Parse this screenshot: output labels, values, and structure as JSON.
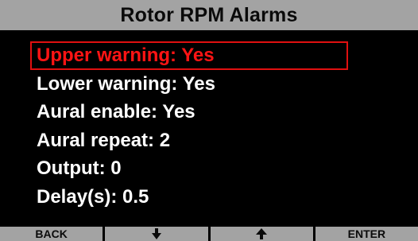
{
  "header": {
    "title": "Rotor RPM Alarms"
  },
  "menu": {
    "items": [
      {
        "label": "Upper warning: Yes",
        "selected": true
      },
      {
        "label": "Lower warning: Yes",
        "selected": false
      },
      {
        "label": "Aural enable: Yes",
        "selected": false
      },
      {
        "label": "Aural repeat: 2",
        "selected": false
      },
      {
        "label": "Output: 0",
        "selected": false
      },
      {
        "label": "Delay(s): 0.5",
        "selected": false
      }
    ]
  },
  "softkeys": {
    "back_label": "BACK",
    "down_icon": "arrow-down-icon",
    "up_icon": "arrow-up-icon",
    "enter_label": "ENTER"
  },
  "colors": {
    "background": "#000000",
    "bar_gray": "#a3a3a3",
    "selection_red": "#ff1414",
    "text_white": "#ffffff"
  }
}
